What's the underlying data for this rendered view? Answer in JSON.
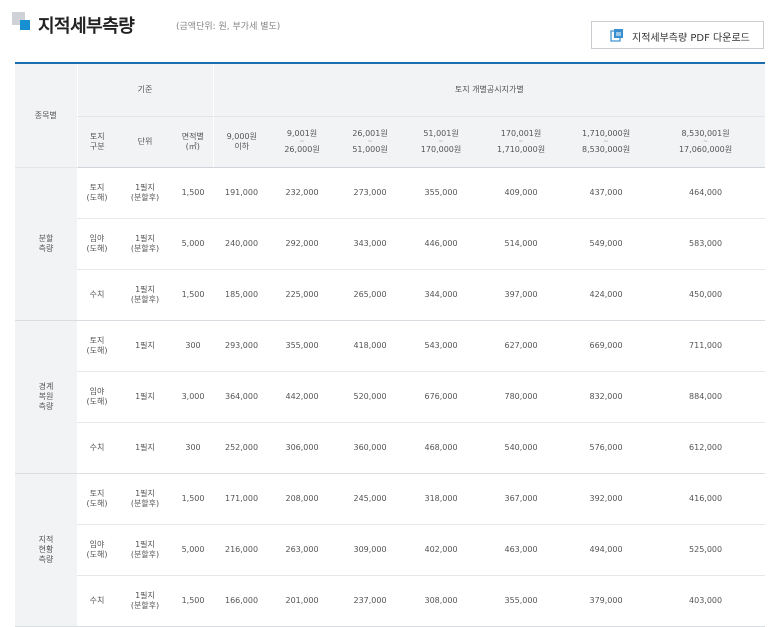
{
  "header": {
    "title": "지적세부측량",
    "note": "(금액단위: 원, 부가세 별도)",
    "pdf_button": "지적세부측량 PDF 다운로드"
  },
  "table": {
    "col_group": "종목별",
    "criteria": "기준",
    "price_group": "토지 개별공시지가별",
    "sub": {
      "land_type": [
        "토지",
        "구분"
      ],
      "unit": "단위",
      "area": [
        "면적별",
        "(㎡)"
      ]
    },
    "price_bands": [
      {
        "top": "9,000원",
        "bottom": "이하",
        "tilde": false
      },
      {
        "top": "9,001원",
        "bottom": "26,000원",
        "tilde": true
      },
      {
        "top": "26,001원",
        "bottom": "51,000원",
        "tilde": true
      },
      {
        "top": "51,001원",
        "bottom": "170,000원",
        "tilde": true
      },
      {
        "top": "170,001원",
        "bottom": "1,710,000원",
        "tilde": true
      },
      {
        "top": "1,710,000원",
        "bottom": "8,530,000원",
        "tilde": true
      },
      {
        "top": "8,530,001원",
        "bottom": "17,060,000원",
        "tilde": true
      }
    ],
    "groups": [
      {
        "name": [
          "분할",
          "측량"
        ],
        "rows": [
          {
            "type": [
              "토지",
              "(도해)"
            ],
            "unit": [
              "1필지",
              "(분할후)"
            ],
            "area": "1,500",
            "prices": [
              "191,000",
              "232,000",
              "273,000",
              "355,000",
              "409,000",
              "437,000",
              "464,000"
            ]
          },
          {
            "type": [
              "임야",
              "(도해)"
            ],
            "unit": [
              "1필지",
              "(분할후)"
            ],
            "area": "5,000",
            "prices": [
              "240,000",
              "292,000",
              "343,000",
              "446,000",
              "514,000",
              "549,000",
              "583,000"
            ]
          },
          {
            "type": [
              "수치"
            ],
            "unit": [
              "1필지",
              "(분할후)"
            ],
            "area": "1,500",
            "prices": [
              "185,000",
              "225,000",
              "265,000",
              "344,000",
              "397,000",
              "424,000",
              "450,000"
            ]
          }
        ]
      },
      {
        "name": [
          "경계",
          "복원",
          "측량"
        ],
        "rows": [
          {
            "type": [
              "토지",
              "(도해)"
            ],
            "unit": [
              "1필지"
            ],
            "area": "300",
            "prices": [
              "293,000",
              "355,000",
              "418,000",
              "543,000",
              "627,000",
              "669,000",
              "711,000"
            ]
          },
          {
            "type": [
              "임야",
              "(도해)"
            ],
            "unit": [
              "1필지"
            ],
            "area": "3,000",
            "prices": [
              "364,000",
              "442,000",
              "520,000",
              "676,000",
              "780,000",
              "832,000",
              "884,000"
            ]
          },
          {
            "type": [
              "수치"
            ],
            "unit": [
              "1필지"
            ],
            "area": "300",
            "prices": [
              "252,000",
              "306,000",
              "360,000",
              "468,000",
              "540,000",
              "576,000",
              "612,000"
            ]
          }
        ]
      },
      {
        "name": [
          "지적",
          "현황",
          "측량"
        ],
        "rows": [
          {
            "type": [
              "토지",
              "(도해)"
            ],
            "unit": [
              "1필지",
              "(분할후)"
            ],
            "area": "1,500",
            "prices": [
              "171,000",
              "208,000",
              "245,000",
              "318,000",
              "367,000",
              "392,000",
              "416,000"
            ]
          },
          {
            "type": [
              "임야",
              "(도해)"
            ],
            "unit": [
              "1필지",
              "(분할후)"
            ],
            "area": "5,000",
            "prices": [
              "216,000",
              "263,000",
              "309,000",
              "402,000",
              "463,000",
              "494,000",
              "525,000"
            ]
          },
          {
            "type": [
              "수치"
            ],
            "unit": [
              "1필지",
              "(분할후)"
            ],
            "area": "1,500",
            "prices": [
              "166,000",
              "201,000",
              "237,000",
              "308,000",
              "355,000",
              "379,000",
              "403,000"
            ]
          }
        ]
      }
    ]
  },
  "icons": {
    "title_mark": "square-bullet-icon",
    "pdf": "document-download-icon"
  },
  "colors": {
    "accent": "#1690d0",
    "header_bg": "#f1f3f5",
    "top_rule": "#1e6fb0"
  }
}
